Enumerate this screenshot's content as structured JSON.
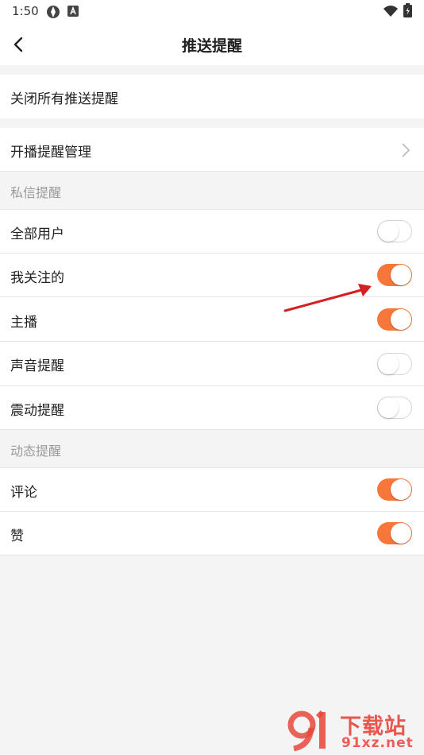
{
  "status": {
    "time": "1:50"
  },
  "header": {
    "title": "推送提醒"
  },
  "rows": {
    "close_all": "关闭所有推送提醒",
    "live_manage": "开播提醒管理"
  },
  "sections": {
    "private": {
      "title": "私信提醒",
      "items": [
        {
          "label": "全部用户",
          "on": false
        },
        {
          "label": "我关注的",
          "on": true
        },
        {
          "label": "主播",
          "on": true
        },
        {
          "label": "声音提醒",
          "on": false
        },
        {
          "label": "震动提醒",
          "on": false
        }
      ]
    },
    "dynamic": {
      "title": "动态提醒",
      "items": [
        {
          "label": "评论",
          "on": true
        },
        {
          "label": "赞",
          "on": true
        }
      ]
    }
  },
  "colors": {
    "accent": "#f7773b",
    "arrow": "#d42020"
  },
  "watermark": {
    "brand": "下载站",
    "domain": "91xz.net"
  }
}
